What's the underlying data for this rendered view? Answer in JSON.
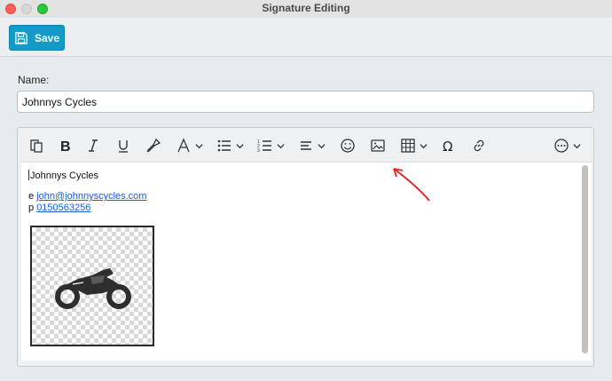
{
  "window": {
    "title": "Signature Editing"
  },
  "toolbar": {
    "save_label": "Save",
    "save_icon": "floppy-disk-icon"
  },
  "form": {
    "name_label": "Name:",
    "name_value": "Johnnys Cycles"
  },
  "editor": {
    "toolbar_items": [
      {
        "name": "paste-icon",
        "has_dropdown": false
      },
      {
        "name": "bold-icon",
        "has_dropdown": false
      },
      {
        "name": "italic-icon",
        "has_dropdown": false
      },
      {
        "name": "underline-icon",
        "has_dropdown": false
      },
      {
        "name": "format-brush-icon",
        "has_dropdown": false
      },
      {
        "name": "font-icon",
        "has_dropdown": true
      },
      {
        "name": "bullet-list-icon",
        "has_dropdown": true
      },
      {
        "name": "numbered-list-icon",
        "has_dropdown": true
      },
      {
        "name": "align-icon",
        "has_dropdown": true
      },
      {
        "name": "emoji-icon",
        "has_dropdown": false
      },
      {
        "name": "image-icon",
        "has_dropdown": false
      },
      {
        "name": "table-icon",
        "has_dropdown": true
      },
      {
        "name": "omega-icon",
        "has_dropdown": false
      },
      {
        "name": "link-icon",
        "has_dropdown": false
      },
      {
        "name": "more-icon",
        "has_dropdown": true
      }
    ],
    "content": {
      "company": "Johnnys Cycles",
      "email_prefix": "e",
      "email": "john@johnnyscycles.com",
      "phone_prefix": "p",
      "phone": "0150563256",
      "logo": "motorcycle-icon"
    }
  },
  "colors": {
    "save_button": "#139ac9",
    "link": "#1a5fd0",
    "annotation_arrow": "#e02020"
  }
}
